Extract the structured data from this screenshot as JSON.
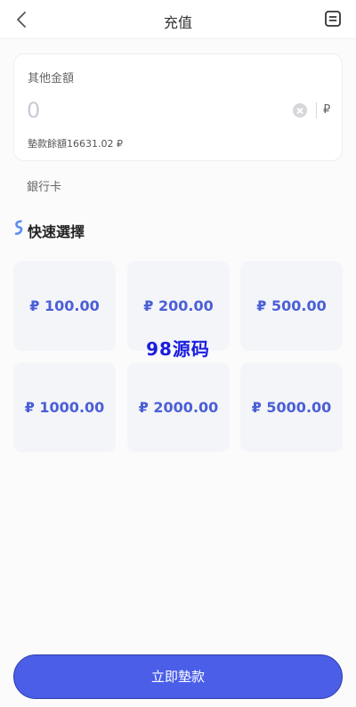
{
  "header": {
    "title": "充值"
  },
  "amount": {
    "label": "其他金額",
    "placeholder": "0",
    "currency": "₽",
    "balance_text": "墊款餘額16631.02 ₽"
  },
  "bank_card_label": "銀行卡",
  "quick_select": {
    "title": "快速選擇",
    "options": [
      {
        "label": "₽ 100.00"
      },
      {
        "label": "₽ 200.00"
      },
      {
        "label": "₽ 500.00"
      },
      {
        "label": "₽ 1000.00"
      },
      {
        "label": "₽ 2000.00"
      },
      {
        "label": "₽ 5000.00"
      }
    ]
  },
  "watermark": "98源码",
  "submit_label": "立即墊款",
  "colors": {
    "accent": "#4a5ee8",
    "option_text": "#4b5fd6",
    "option_bg": "#f4f5f9"
  },
  "icons": {
    "back": "chevron-left-icon",
    "record": "record-list-icon",
    "quick_select": "s-ribbon-icon",
    "clear": "clear-circle-icon"
  }
}
